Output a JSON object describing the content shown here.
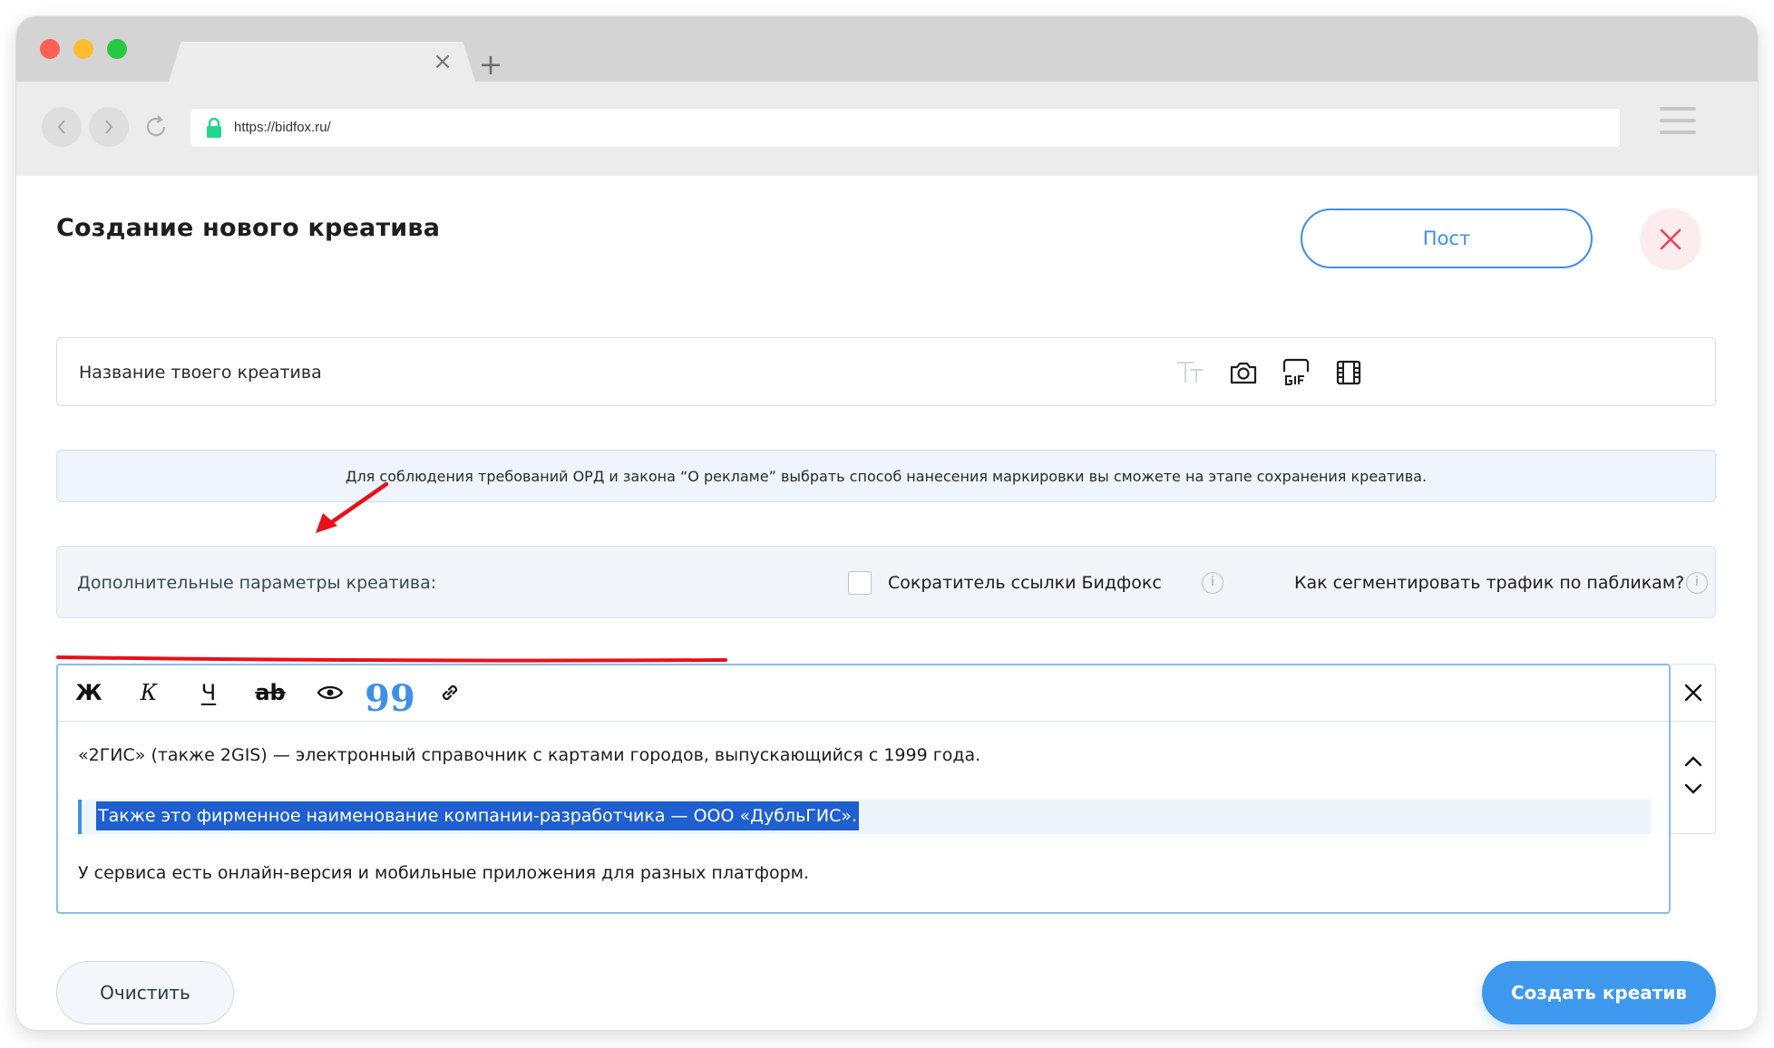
{
  "browser": {
    "url": "https://bidfox.ru/",
    "tab_close": "×",
    "tab_new": "+"
  },
  "page": {
    "title": "Создание нового креатива",
    "post_button": "Пост",
    "name_placeholder": "Название твоего креатива",
    "notice": "Для соблюдения требований ОРД и закона “О рекламе” выбрать способ нанесения маркировки вы сможете на этапе сохранения креатива.",
    "params_label": "Дополнительные параметры креатива:",
    "shortener_label": "Сократитель ссылки Бидфокс",
    "segment_label": "Как сегментировать трафик по пабликам?",
    "info_glyph": "i",
    "clear_button": "Очистить",
    "create_button": "Создать креатив"
  },
  "editor": {
    "toolbar": {
      "bold": "Ж",
      "italic": "К",
      "underline": "Ч",
      "strike": "ab",
      "quote": "99"
    },
    "paragraphs": [
      "«2ГИС» (также 2GIS) — электронный справочник с картами городов, выпускающийся с 1999 года.",
      "Также это фирменное наименование компании-разработчика — ООО «ДубльГИС».",
      "У сервиса есть онлайн-версия и мобильные приложения для разных платформ."
    ]
  },
  "colors": {
    "accent": "#3e8fe8",
    "selection": "#1f5fd0",
    "annotation": "#e8101a",
    "close": "#e8455a"
  }
}
